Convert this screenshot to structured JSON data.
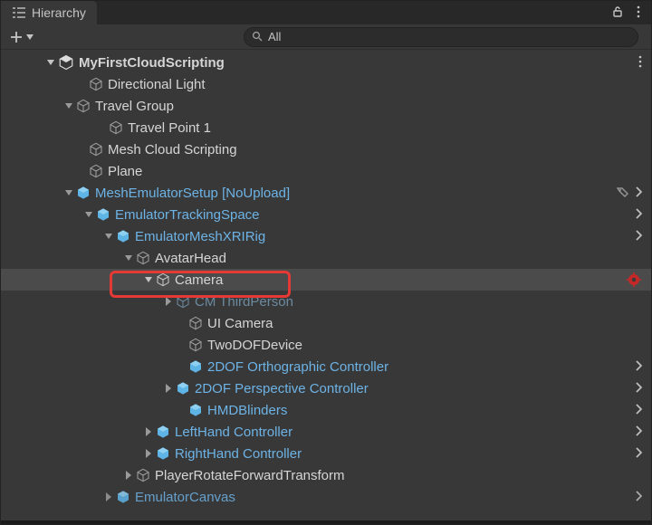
{
  "panel": {
    "title": "Hierarchy"
  },
  "toolbar": {
    "search_value": "All",
    "search_placeholder": ""
  },
  "scene": {
    "name": "MyFirstCloudScripting"
  },
  "rows": {
    "dirLight": "Directional Light",
    "travelGroup": "Travel Group",
    "travelPoint1": "Travel Point 1",
    "meshCloud": "Mesh Cloud Scripting",
    "plane": "Plane",
    "meshEmu": "MeshEmulatorSetup [NoUpload]",
    "trackSpace": "EmulatorTrackingSpace",
    "xriRig": "EmulatorMeshXRIRig",
    "avatarHead": "AvatarHead",
    "camera": "Camera",
    "cmThird": "CM ThirdPerson",
    "uiCamera": "UI Camera",
    "twoDof": "TwoDOFDevice",
    "ortho": "2DOF Orthographic Controller",
    "persp": "2DOF Perspective Controller",
    "blinders": "HMDBlinders",
    "leftHand": "LeftHand Controller",
    "rightHand": "RightHand Controller",
    "playerRotate": "PlayerRotateForwardTransform",
    "emuCanvas": "EmulatorCanvas"
  }
}
